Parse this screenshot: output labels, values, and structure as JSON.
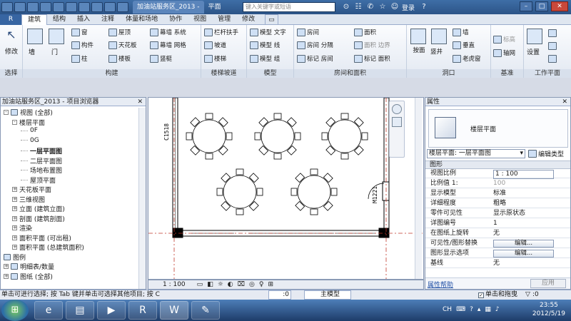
{
  "titlebar": {
    "tabs": [
      "加油站服务区_2013 -",
      "平面"
    ],
    "search_placeholder": "键入关键字或短语",
    "login": "登录"
  },
  "ribbon": {
    "tabs": [
      "建筑",
      "结构",
      "插入",
      "注释",
      "体量和场地",
      "协作",
      "视图",
      "管理",
      "修改"
    ],
    "active_tab": "建筑",
    "panels": {
      "select": {
        "label": "选择",
        "modify": "修改"
      },
      "build": {
        "label": "构建",
        "wall": "墙",
        "door": "门",
        "window": "窗",
        "component": "构件",
        "column": "柱",
        "roof": "屋顶",
        "ceiling": "天花板",
        "floor": "楼板",
        "curtain_system": "幕墙 系统",
        "curtain_grid": "幕墙 网格",
        "mullion": "竖梃"
      },
      "circulation": {
        "label": "楼梯坡道",
        "railing": "栏杆扶手",
        "ramp": "坡道",
        "stair": "楼梯"
      },
      "model": {
        "label": "模型",
        "model_text": "模型 文字",
        "model_line": "模型 线",
        "model_group": "模型 组"
      },
      "room": {
        "label": "房间和面积",
        "room": "房间",
        "room_sep": "房间 分隔",
        "tag_room": "标记 房间",
        "area": "面积",
        "area_boundary": "面积 边界",
        "tag_area": "标记 面积"
      },
      "opening": {
        "label": "洞口",
        "by_face": "按面",
        "shaft": "竖井",
        "wall": "墙",
        "vertical": "垂直",
        "dormer": "老虎窗"
      },
      "datum": {
        "label": "基准",
        "level": "标高",
        "grid": "轴网"
      },
      "workplane": {
        "label": "工作平面",
        "set": "设置"
      }
    }
  },
  "browser": {
    "title": "加油站服务区_2013 - 项目浏览器",
    "items": [
      {
        "label": "视图 (全部)",
        "level": 0,
        "toggle": "-"
      },
      {
        "label": "楼层平面",
        "level": 1,
        "toggle": "-"
      },
      {
        "label": "0F",
        "level": 2,
        "toggle": ""
      },
      {
        "label": "0G",
        "level": 2,
        "toggle": ""
      },
      {
        "label": "一层平面图",
        "level": 2,
        "toggle": "",
        "bold": true
      },
      {
        "label": "二层平面图",
        "level": 2,
        "toggle": ""
      },
      {
        "label": "场地布置图",
        "level": 2,
        "toggle": ""
      },
      {
        "label": "屋顶平面",
        "level": 2,
        "toggle": ""
      },
      {
        "label": "天花板平面",
        "level": 1,
        "toggle": "+"
      },
      {
        "label": "三维视图",
        "level": 1,
        "toggle": "+"
      },
      {
        "label": "立面 (建筑立面)",
        "level": 1,
        "toggle": "+"
      },
      {
        "label": "剖面 (建筑剖面)",
        "level": 1,
        "toggle": "+"
      },
      {
        "label": "渲染",
        "level": 1,
        "toggle": "+"
      },
      {
        "label": "面积平面 (可出租)",
        "level": 1,
        "toggle": "+"
      },
      {
        "label": "面积平面 (总建筑面积)",
        "level": 1,
        "toggle": "+"
      },
      {
        "label": "图例",
        "level": 0,
        "toggle": ""
      },
      {
        "label": "明细表/数量",
        "level": 0,
        "toggle": "+"
      },
      {
        "label": "图纸 (全部)",
        "level": 0,
        "toggle": "+"
      }
    ]
  },
  "canvas": {
    "tag_left": "C1518",
    "tag_right": "M1221",
    "scale": "1 : 100"
  },
  "properties": {
    "title": "属性",
    "type_name": "楼层平面",
    "selector": "楼层平面: 一层平面图",
    "edit_type": "编辑类型",
    "section": "图形",
    "rows": [
      {
        "k": "视图比例",
        "v": "1 : 100"
      },
      {
        "k": "比例值 1:",
        "v": "100",
        "dim": true
      },
      {
        "k": "显示模型",
        "v": "标准"
      },
      {
        "k": "详细程度",
        "v": "粗略"
      },
      {
        "k": "零件可见性",
        "v": "显示原状态"
      },
      {
        "k": "详图编号",
        "v": "1"
      },
      {
        "k": "在图纸上旋转",
        "v": "无"
      },
      {
        "k": "可见性/图形替换",
        "v": "编辑...",
        "button": true
      },
      {
        "k": "图形显示选项",
        "v": "编辑...",
        "button": true
      },
      {
        "k": "基线",
        "v": "无"
      }
    ],
    "help": "属性帮助",
    "apply": "应用"
  },
  "status": {
    "text": "单击可进行选择; 按 Tab 键并单击可选择其他项目; 按 C",
    "filter_value": ":0",
    "main_model": "主模型",
    "drag_label": "单击和拖曳",
    "filter_count": ":0"
  },
  "taskbar": {
    "time": "23:55",
    "date": "2012/5/19",
    "lang": "CH"
  }
}
